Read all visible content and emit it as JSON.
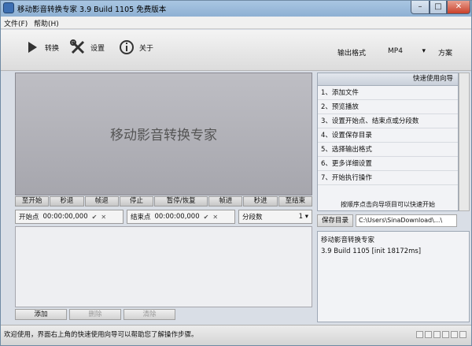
{
  "title_bar": {
    "title": "移动影音转换专家 3.9 Build 1105 免费版本",
    "min": "–",
    "max": "□",
    "close": "✕"
  },
  "menu": {
    "items": [
      "文件(F)",
      "帮助(H)"
    ]
  },
  "toolbar": {
    "convert_label": "转换",
    "settings_label": "设置",
    "about_label": "关于",
    "output_format_label": "输出格式",
    "output_format_value": "MP4",
    "scheme_label": "方案"
  },
  "preview": {
    "watermark": "移动影音转换专家"
  },
  "controls": [
    "至开始",
    "秒退",
    "帧退",
    "停止",
    "暂停/恢复",
    "帧进",
    "秒进",
    "至结束"
  ],
  "points": {
    "start_label": "开始点",
    "start_value": "00:00:00,000",
    "end_label": "结束点",
    "end_value": "00:00:00,000",
    "segments_label": "分段数",
    "segments_value": "1"
  },
  "bottom_buttons": {
    "add": "添加",
    "delete": "删除",
    "clear": "清除"
  },
  "wizard": {
    "title": "快速使用向导",
    "steps": [
      "1、添加文件",
      "2、预览播放",
      "3、设置开始点、结束点或分段数",
      "4、设置保存目录",
      "5、选择输出格式",
      "6、更多详细设置",
      "7、开始执行操作"
    ],
    "hint": "按顺序点击向导项目可以快速开始"
  },
  "save": {
    "label": "保存目录",
    "path": "C:\\Users\\SinaDownload\\...\\"
  },
  "info": {
    "line1": "移动影音转换专家",
    "line2": "3.9 Build 1105 [init 18172ms]"
  },
  "status": {
    "text": "欢迎使用，界面右上角的快速使用向导可以帮助您了解操作步骤。"
  }
}
